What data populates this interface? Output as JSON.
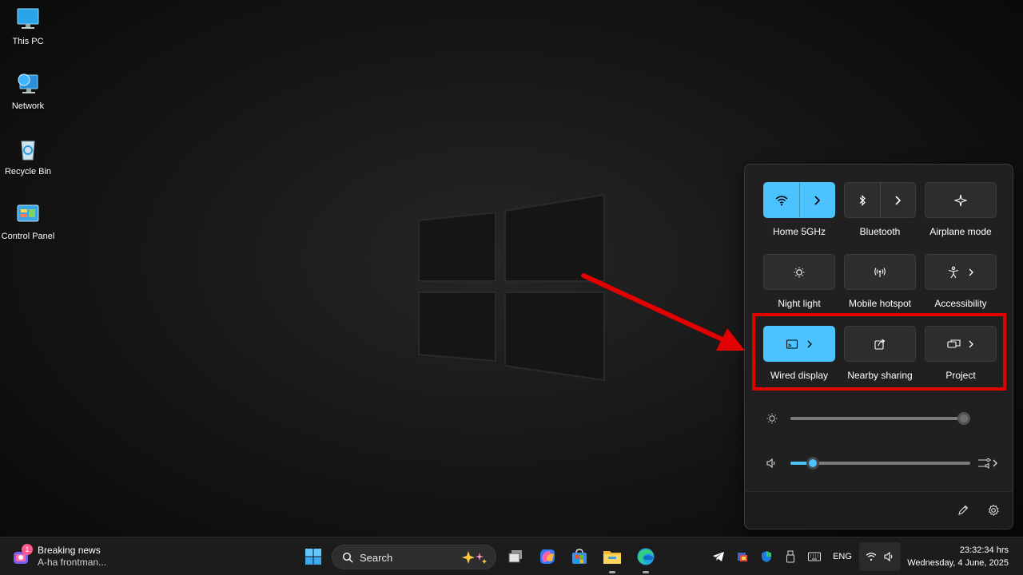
{
  "desktop": {
    "icons": [
      {
        "label": "This PC"
      },
      {
        "label": "Network"
      },
      {
        "label": "Recycle Bin"
      },
      {
        "label": "Control Panel"
      }
    ]
  },
  "quick_settings": {
    "tiles": [
      {
        "label": "Home 5GHz",
        "icon": "wifi-icon",
        "on": true
      },
      {
        "label": "Bluetooth",
        "icon": "bluetooth-icon",
        "on": false
      },
      {
        "label": "Airplane mode",
        "icon": "airplane-icon",
        "on": false
      },
      {
        "label": "Night light",
        "icon": "night-light-icon",
        "on": false
      },
      {
        "label": "Mobile hotspot",
        "icon": "hotspot-icon",
        "on": false
      },
      {
        "label": "Accessibility",
        "icon": "accessibility-icon",
        "on": false
      },
      {
        "label": "Wired display",
        "icon": "cast-icon",
        "on": true
      },
      {
        "label": "Nearby sharing",
        "icon": "share-icon",
        "on": false
      },
      {
        "label": "Project",
        "icon": "project-icon",
        "on": false
      }
    ],
    "brightness_level": 1.0,
    "volume_level": 0.13,
    "accent_color": "#4cc2ff"
  },
  "annotation": {
    "highlight_color": "#e30000"
  },
  "taskbar": {
    "news_badge": "1",
    "news_title": "Breaking news",
    "news_subtitle": "A-ha frontman...",
    "search_placeholder": "Search",
    "language": "ENG",
    "time": "23:32:34 hrs",
    "date": "Wednesday, 4 June, 2025"
  }
}
